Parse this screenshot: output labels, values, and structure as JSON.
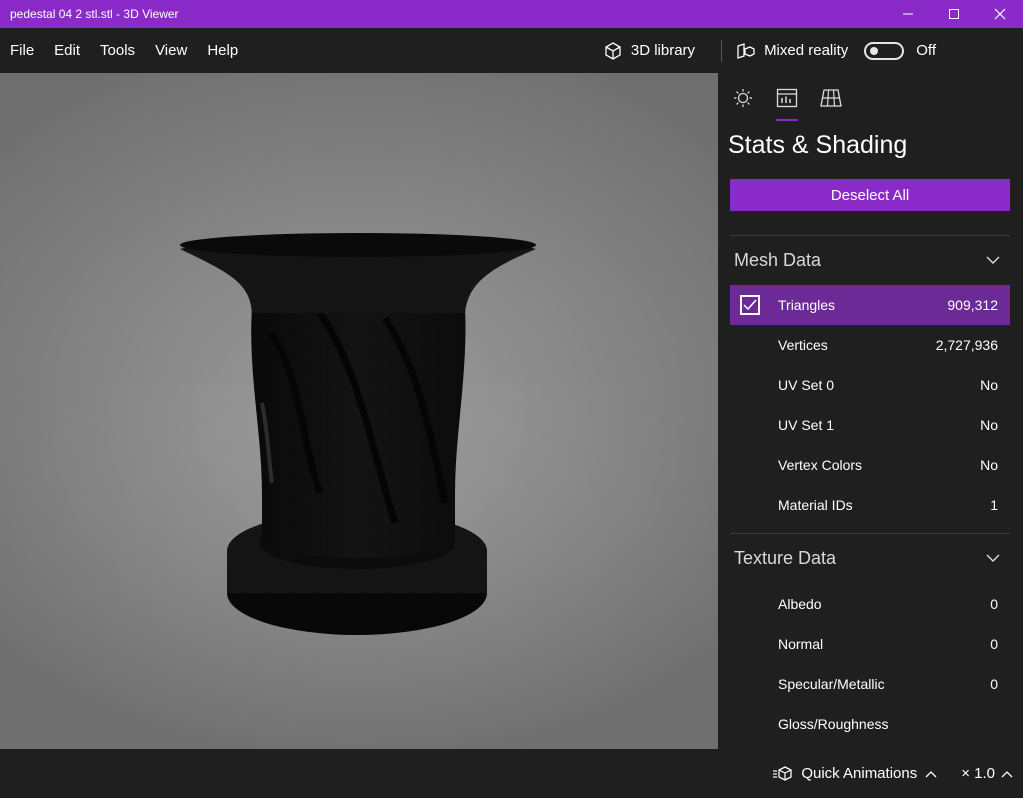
{
  "window": {
    "title": "pedestal 04 2 stl.stl - 3D Viewer"
  },
  "menu": {
    "items": [
      "File",
      "Edit",
      "Tools",
      "View",
      "Help"
    ],
    "library_label": "3D library",
    "mixed_reality_label": "Mixed reality",
    "mixed_reality_state": "Off",
    "mixed_reality_on": false
  },
  "panel": {
    "title": "Stats & Shading",
    "deselect_label": "Deselect All",
    "mesh_section": "Mesh Data",
    "mesh_rows": [
      {
        "label": "Triangles",
        "value": "909,312",
        "checked": true
      },
      {
        "label": "Vertices",
        "value": "2,727,936"
      },
      {
        "label": "UV Set 0",
        "value": "No"
      },
      {
        "label": "UV Set 1",
        "value": "No"
      },
      {
        "label": "Vertex Colors",
        "value": "No"
      },
      {
        "label": "Material IDs",
        "value": "1"
      }
    ],
    "texture_section": "Texture Data",
    "texture_rows": [
      {
        "label": "Albedo",
        "value": "0"
      },
      {
        "label": "Normal",
        "value": "0"
      },
      {
        "label": "Specular/Metallic",
        "value": "0"
      },
      {
        "label": "Gloss/Roughness",
        "value": ""
      }
    ]
  },
  "bottom": {
    "animations_label": "Quick Animations",
    "speed_label": "× 1.0"
  },
  "colors": {
    "accent": "#8a2bc9",
    "selected_row": "#6b2a96",
    "background": "#1f1f1f"
  }
}
